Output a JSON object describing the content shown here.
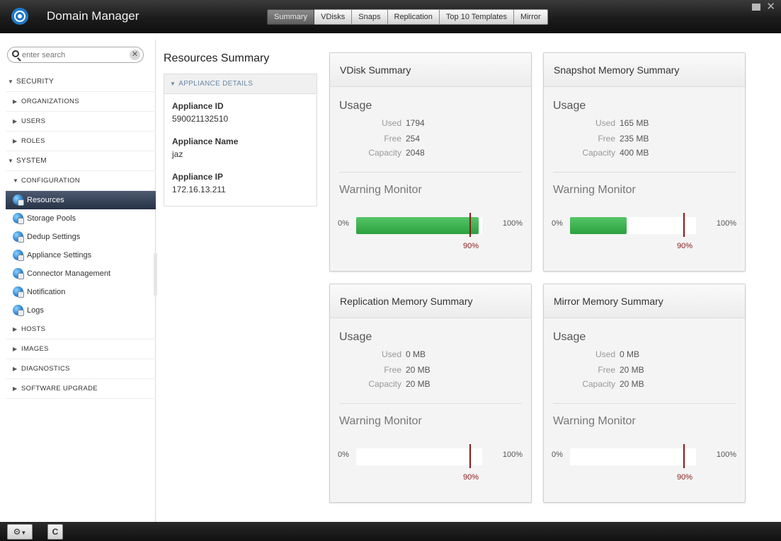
{
  "app": {
    "title": "Domain Manager",
    "logo_icon": "domain-manager-logo-icon"
  },
  "tabs": [
    {
      "label": "Summary",
      "active": true
    },
    {
      "label": "VDisks",
      "active": false
    },
    {
      "label": "Snaps",
      "active": false
    },
    {
      "label": "Replication",
      "active": false
    },
    {
      "label": "Top 10 Templates",
      "active": false
    },
    {
      "label": "Mirror",
      "active": false
    }
  ],
  "window_controls": {
    "minimize_icon": "minimize-icon",
    "close_icon": "close-icon"
  },
  "search": {
    "placeholder": "enter search",
    "value": "",
    "clear_icon": "clear-icon"
  },
  "sidebar": {
    "security": {
      "label": "SECURITY",
      "children": [
        "ORGANIZATIONS",
        "USERS",
        "ROLES"
      ]
    },
    "system": {
      "label": "SYSTEM",
      "configuration": {
        "label": "CONFIGURATION",
        "items": [
          {
            "label": "Resources",
            "active": true,
            "icon": "globe-icon"
          },
          {
            "label": "Storage Pools",
            "active": false,
            "icon": "globe-icon"
          },
          {
            "label": "Dedup Settings",
            "active": false,
            "icon": "globe-icon"
          },
          {
            "label": "Appliance Settings",
            "active": false,
            "icon": "globe-icon"
          },
          {
            "label": "Connector Management",
            "active": false,
            "icon": "globe-icon"
          },
          {
            "label": "Notification",
            "active": false,
            "icon": "globe-icon"
          },
          {
            "label": "Logs",
            "active": false,
            "icon": "globe-icon"
          }
        ]
      },
      "children": [
        "HOSTS",
        "IMAGES",
        "DIAGNOSTICS",
        "SOFTWARE UPGRADE"
      ]
    }
  },
  "resources": {
    "title": "Resources Summary",
    "details_header": "APPLIANCE DETAILS",
    "appliance_id_label": "Appliance ID",
    "appliance_id": "590021132510",
    "appliance_name_label": "Appliance Name",
    "appliance_name": "jaz",
    "appliance_ip_label": "Appliance IP",
    "appliance_ip": "172.16.13.211"
  },
  "cards": [
    {
      "title": "VDisk Summary",
      "usage_title": "Usage",
      "used_label": "Used",
      "used": "1794",
      "free_label": "Free",
      "free": "254",
      "capacity_label": "Capacity",
      "capacity": "2048",
      "monitor_title": "Warning Monitor",
      "min_label": "0%",
      "max_label": "100%",
      "threshold_label": "90%",
      "fill_fraction": 0.97,
      "threshold_fraction": 0.9
    },
    {
      "title": "Snapshot Memory Summary",
      "usage_title": "Usage",
      "used_label": "Used",
      "used": "165 MB",
      "free_label": "Free",
      "free": "235 MB",
      "capacity_label": "Capacity",
      "capacity": "400 MB",
      "monitor_title": "Warning Monitor",
      "min_label": "0%",
      "max_label": "100%",
      "threshold_label": "90%",
      "fill_fraction": 0.45,
      "threshold_fraction": 0.9
    },
    {
      "title": "Replication Memory Summary",
      "usage_title": "Usage",
      "used_label": "Used",
      "used": "0 MB",
      "free_label": "Free",
      "free": "20 MB",
      "capacity_label": "Capacity",
      "capacity": "20 MB",
      "monitor_title": "Warning Monitor",
      "min_label": "0%",
      "max_label": "100%",
      "threshold_label": "90%",
      "fill_fraction": 0,
      "threshold_fraction": 0.9
    },
    {
      "title": "Mirror Memory Summary",
      "usage_title": "Usage",
      "used_label": "Used",
      "used": "0 MB",
      "free_label": "Free",
      "free": "20 MB",
      "capacity_label": "Capacity",
      "capacity": "20 MB",
      "monitor_title": "Warning Monitor",
      "min_label": "0%",
      "max_label": "100%",
      "threshold_label": "90%",
      "fill_fraction": 0,
      "threshold_fraction": 0.9
    }
  ],
  "bottom": {
    "settings_icon": "gear-icon",
    "settings_dropdown_icon": "chevron-down-icon",
    "refresh_label": "C"
  },
  "colors": {
    "accent": "#2ca13f",
    "threshold": "#8b1a1a",
    "selection": "#273246",
    "header": "#1c1c1c"
  }
}
